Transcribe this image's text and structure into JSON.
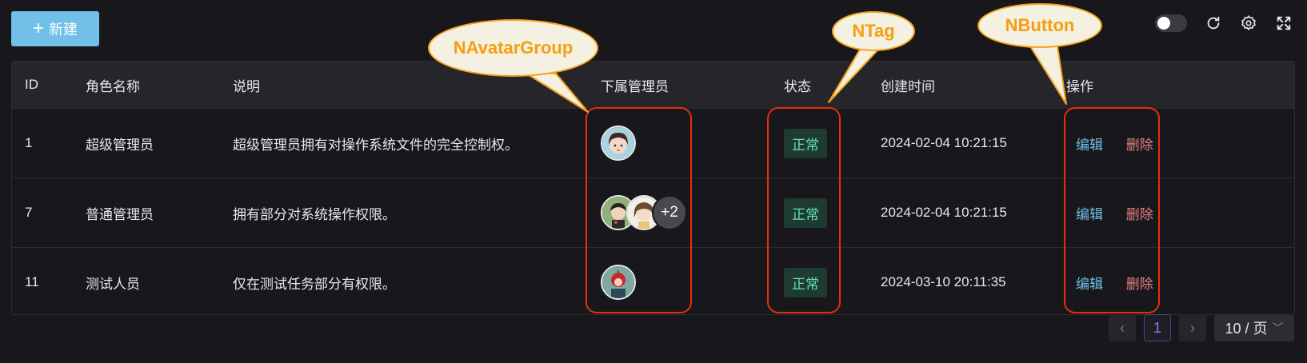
{
  "toolbar": {
    "new_label": "新建"
  },
  "table": {
    "headers": [
      "ID",
      "角色名称",
      "说明",
      "下属管理员",
      "状态",
      "创建时间",
      "操作"
    ],
    "rows": [
      {
        "id": "1",
        "name": "超级管理员",
        "desc": "超级管理员拥有对操作系统文件的完全控制权。",
        "status": "正常",
        "created": "2024-02-04 10:21:15",
        "edit": "编辑",
        "delete": "删除"
      },
      {
        "id": "7",
        "name": "普通管理员",
        "desc": "拥有部分对系统操作权限。",
        "more": "+2",
        "status": "正常",
        "created": "2024-02-04 10:21:15",
        "edit": "编辑",
        "delete": "删除"
      },
      {
        "id": "11",
        "name": "测试人员",
        "desc": "仅在测试任务部分有权限。",
        "status": "正常",
        "created": "2024-03-10 20:11:35",
        "edit": "编辑",
        "delete": "删除"
      }
    ]
  },
  "pagination": {
    "page": "1",
    "page_size": "10 / 页"
  },
  "annotations": {
    "avatar_group": "NAvatarGroup",
    "tag": "NTag",
    "button": "NButton"
  },
  "colors": {
    "primary": "#70c0e8",
    "success": "#63e2b7",
    "error": "#e88080",
    "annotation_red": "#e62e08",
    "annotation_orange": "#f59f0f"
  },
  "icons": [
    "plus-icon",
    "theme-toggle",
    "refresh-icon",
    "settings-icon",
    "fullscreen-icon",
    "chevron-left-icon",
    "chevron-right-icon",
    "chevron-down-icon"
  ]
}
